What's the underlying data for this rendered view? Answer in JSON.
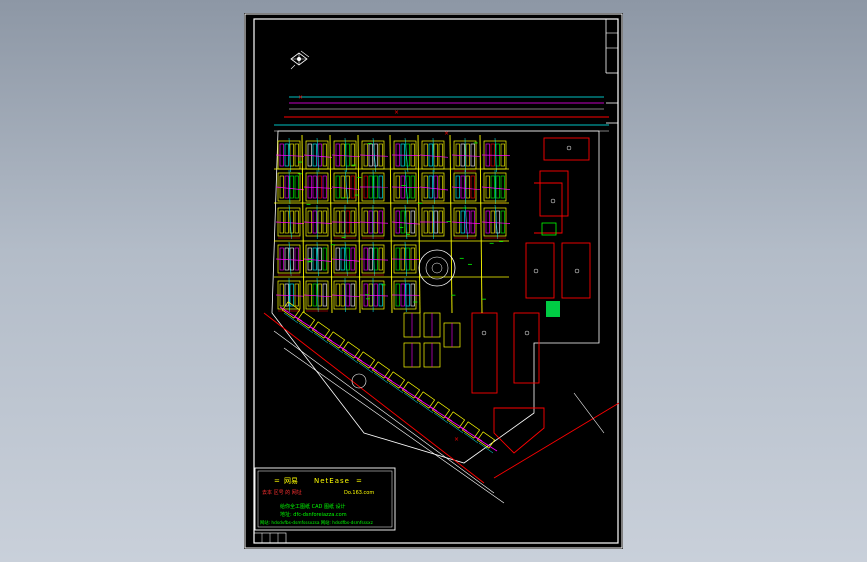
{
  "app": {
    "viewport_background": "#a8b1bd"
  },
  "sheet": {
    "background": "#000000",
    "border_color": "#ffffff"
  },
  "title_block": {
    "brand_cn": "网易",
    "brand_en": "NetEase",
    "line2_left": "去本 区号 的 网址",
    "line2_right": "Do.163.com",
    "line3": "给你全工图纸 CAD 图纸 设计",
    "line4": "地址: dfc-dsnforeiazza.com",
    "line5": "网站: hdsdvfbs-dsmfsssxzsa 网站: hdsdfbs-dsmfsssxz",
    "text_color_accent": "#ffff00",
    "text_color_main": "#00ff00",
    "text_color_warn": "#ff3030"
  },
  "colors": {
    "yellow": "#ffff00",
    "magenta": "#ff00ff",
    "cyan": "#00ffff",
    "green": "#00ff00",
    "red": "#ff0000",
    "white": "#ffffff"
  }
}
